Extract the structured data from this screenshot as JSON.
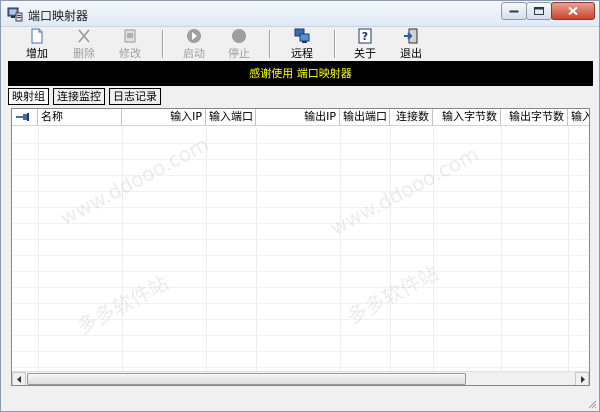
{
  "window": {
    "title": "端口映射器"
  },
  "toolbar": {
    "add_label": "增加",
    "delete_label": "删除",
    "edit_label": "修改",
    "start_label": "启动",
    "stop_label": "停止",
    "remote_label": "远程",
    "about_label": "关于",
    "exit_label": "退出"
  },
  "banner": {
    "text": "感谢使用 端口映射器"
  },
  "tabs": [
    {
      "label": "映射组"
    },
    {
      "label": "连接监控"
    },
    {
      "label": "日志记录"
    }
  ],
  "table": {
    "columns": [
      {
        "label": "名称"
      },
      {
        "label": "输入IP"
      },
      {
        "label": "输入端口"
      },
      {
        "label": "输出IP"
      },
      {
        "label": "输出端口"
      },
      {
        "label": "连接数"
      },
      {
        "label": "输入字节数"
      },
      {
        "label": "输出字节数"
      },
      {
        "label": "输入"
      }
    ],
    "rows": []
  },
  "watermark": {
    "text": "www.ddooo.com",
    "text2": "多多软件站"
  },
  "colors": {
    "banner_bg": "#000000",
    "banner_text": "#ffff00"
  }
}
